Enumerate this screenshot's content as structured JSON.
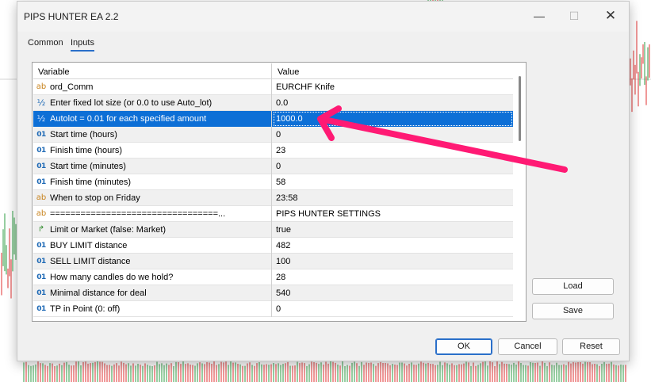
{
  "window": {
    "title": "PIPS HUNTER EA 2.2",
    "minimize_glyph": "—",
    "maximize_glyph": "☐",
    "close_glyph": "✕"
  },
  "tabs": [
    {
      "label": "Common",
      "active": false
    },
    {
      "label": "Inputs",
      "active": true
    }
  ],
  "table": {
    "headers": {
      "variable": "Variable",
      "value": "Value"
    },
    "rows": [
      {
        "type": "string",
        "icon_glyph": "ab",
        "variable": "ord_Comm",
        "value": "EURCHF Knife"
      },
      {
        "type": "double",
        "icon_glyph": "½",
        "variable": "Enter fixed lot size (or 0.0 to use Auto_lot)",
        "value": "0.0"
      },
      {
        "type": "double",
        "icon_glyph": "½",
        "variable": "Autolot = 0.01 for each specified amount",
        "value": "1000.0",
        "selected": true
      },
      {
        "type": "int",
        "icon_glyph": "01",
        "variable": "Start time (hours)",
        "value": "0"
      },
      {
        "type": "int",
        "icon_glyph": "01",
        "variable": "Finish time (hours)",
        "value": "23"
      },
      {
        "type": "int",
        "icon_glyph": "01",
        "variable": "Start time (minutes)",
        "value": "0"
      },
      {
        "type": "int",
        "icon_glyph": "01",
        "variable": "Finish time (minutes)",
        "value": "58"
      },
      {
        "type": "string",
        "icon_glyph": "ab",
        "variable": "When to stop on Friday",
        "value": "23:58"
      },
      {
        "type": "string",
        "icon_glyph": "ab",
        "variable": "=================================...",
        "value": "PIPS HUNTER SETTINGS"
      },
      {
        "type": "bool",
        "icon_glyph": "↱",
        "variable": "Limit or Market (false: Market)",
        "value": "true"
      },
      {
        "type": "int",
        "icon_glyph": "01",
        "variable": "BUY LIMIT distance",
        "value": "482"
      },
      {
        "type": "int",
        "icon_glyph": "01",
        "variable": "SELL LIMIT distance",
        "value": "100"
      },
      {
        "type": "int",
        "icon_glyph": "01",
        "variable": "How many candles do we hold?",
        "value": "28"
      },
      {
        "type": "int",
        "icon_glyph": "01",
        "variable": "Minimal distance for deal",
        "value": "540"
      },
      {
        "type": "int",
        "icon_glyph": "01",
        "variable": "TP in Point (0: off)",
        "value": "0"
      }
    ]
  },
  "buttons": {
    "load": "Load",
    "save": "Save",
    "ok": "OK",
    "cancel": "Cancel",
    "reset": "Reset"
  },
  "colors": {
    "selection": "#0d6fd6",
    "annotation_arrow": "#ff1a74",
    "candle_green": "#2f9e44",
    "candle_red": "#e03131"
  }
}
